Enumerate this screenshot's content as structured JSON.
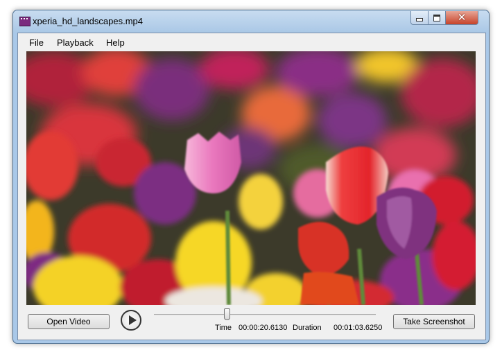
{
  "window": {
    "title": "xperia_hd_landscapes.mp4",
    "controls": [
      "minimize",
      "maximize",
      "close"
    ],
    "close_glyph": "✕"
  },
  "menu": [
    "File",
    "Playback",
    "Help"
  ],
  "video": {
    "content": "video-frame-tulips"
  },
  "controls": {
    "open_label": "Open Video",
    "play_icon": "play-icon",
    "seek_fraction": 0.327,
    "time_label": "Time",
    "time_value": "00:00:20.6130",
    "duration_label": "Duration",
    "duration_value": "00:01:03.6250",
    "screenshot_label": "Take Screenshot"
  },
  "colors": {
    "titlebar": "#aac8e6",
    "close_button": "#c7432a",
    "face": "#f0f0f0"
  }
}
